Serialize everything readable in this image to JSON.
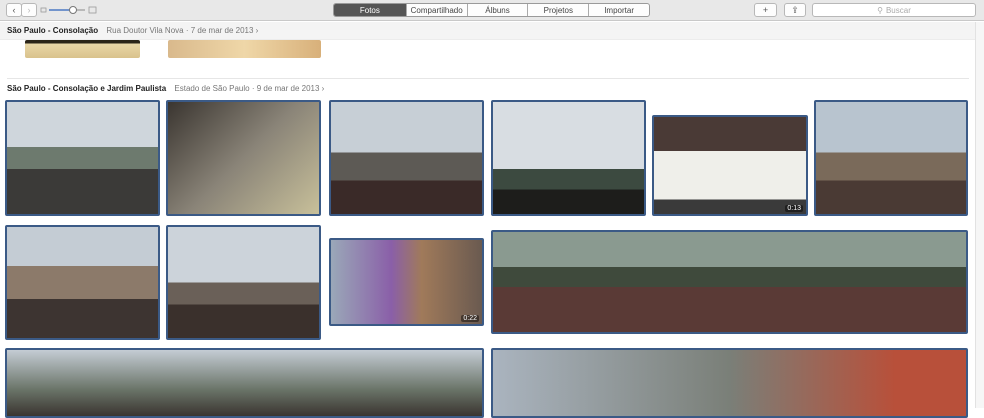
{
  "toolbar": {
    "tabs": [
      "Fotos",
      "Compartilhado",
      "Álbuns",
      "Projetos",
      "Importar"
    ],
    "search_placeholder": "Buscar",
    "back": "‹",
    "forward": "›",
    "add": "+",
    "share": "⇪"
  },
  "moments": [
    {
      "title": "São Paulo - Consolação",
      "location": "Rua Doutor Vila Nova",
      "date": "7 de mar de 2013 ›"
    },
    {
      "title": "São Paulo - Consolação e Jardim Paulista",
      "location": "Estado de São Paulo",
      "date": "9 de mar de 2013 ›"
    }
  ],
  "videos": {
    "v1": "0:13",
    "v2": "0:22"
  }
}
